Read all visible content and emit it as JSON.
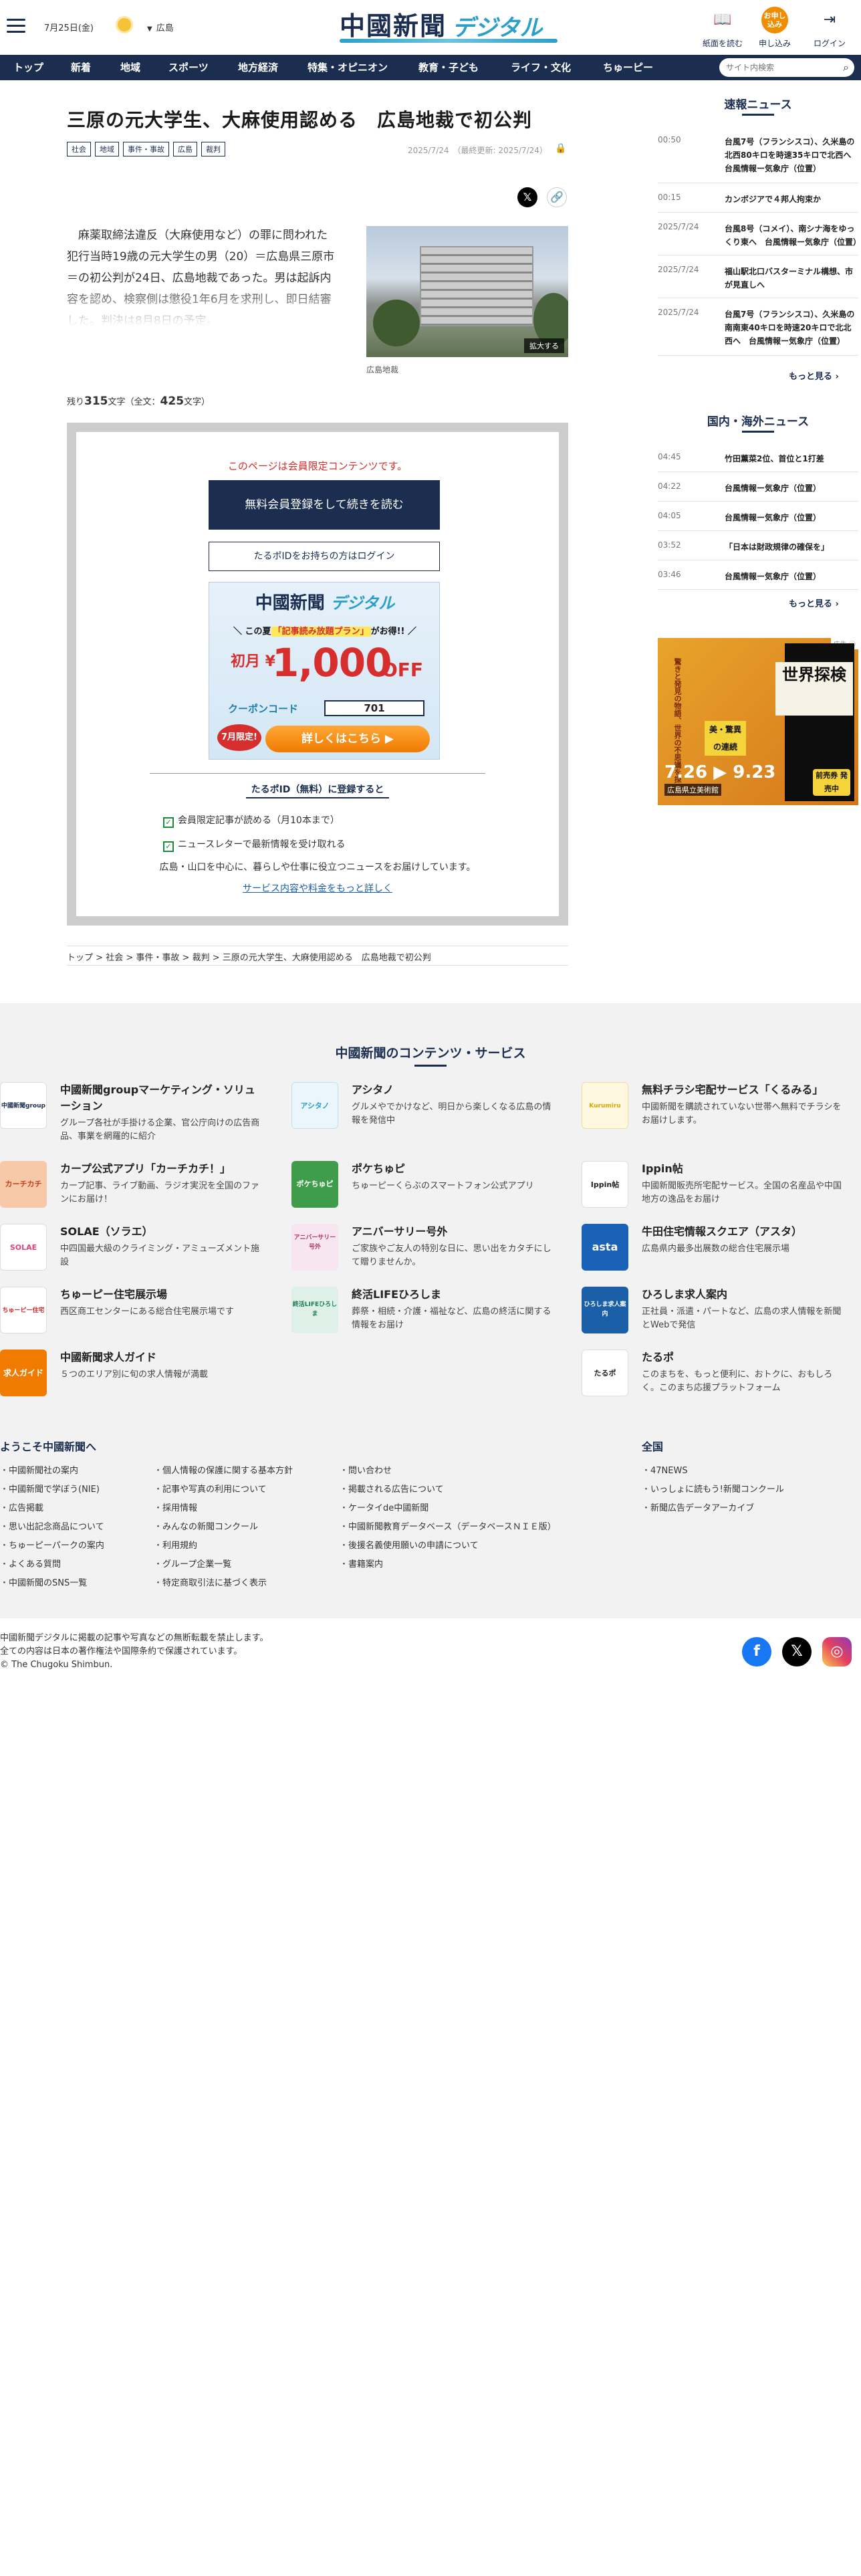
{
  "header": {
    "date": "7月25日(金)",
    "region": "広島",
    "logo_main": "中國新聞",
    "logo_sub": "デジタル",
    "btn_paper": "紙面を読む",
    "btn_apply_icon": "お申し込み",
    "btn_apply": "申し込み",
    "btn_login": "ログイン"
  },
  "nav": {
    "items": [
      "トップ",
      "新着",
      "地域",
      "スポーツ",
      "地方経済",
      "特集・オピニオン",
      "教育・子ども",
      "ライフ・文化",
      "ちゅーピー"
    ],
    "search_placeholder": "サイト内検索"
  },
  "article": {
    "title": "三原の元大学生、大麻使用認める　広島地裁で初公判",
    "tags": [
      "社会",
      "地域",
      "事件・事故",
      "広島",
      "裁判"
    ],
    "date": "2025/7/24",
    "updated": "（最終更新: 2025/7/24）",
    "lead": "麻薬取締法違反（大麻使用など）の罪に問われた犯行当時19歳の元大学生の男（20）＝広島県三原市＝の初公判が24日、広島地裁であった。男は起訴内容を認め、検察側は懲役1年6月を求刑し、即日結審した。判決は8月8日の予定。",
    "photo_expand": "拡大する",
    "photo_caption": "広島地裁",
    "remain_pre": "残り",
    "remain_num": "315",
    "remain_mid": "文字（全文：",
    "total_num": "425",
    "remain_post": "文字）"
  },
  "paywall": {
    "notice": "このページは会員限定コンテンツです。",
    "register": "無料会員登録をして続きを読む",
    "login": "たるポIDをお持ちの方はログイン",
    "banner_logo_main": "中國新聞",
    "banner_logo_sub": "デジタル",
    "banner_promo_pre": "＼ この夏",
    "banner_promo_em": "「記事読み放題プラン」",
    "banner_promo_post": "がお得!! ／",
    "banner_price_pre": "初月 ¥",
    "banner_price": "1,000",
    "banner_off": "OFF",
    "banner_coupon_label": "クーポンコード",
    "banner_coupon_code": "701",
    "banner_limit": "7月限定!",
    "banner_cta": "詳しくはこちら ▶",
    "benefit_heading": "たるポID（無料）に登録すると",
    "benefits": [
      "会員限定記事が読める（月10本まで）",
      "ニュースレターで最新情報を受け取れる"
    ],
    "desc": "広島・山口を中心に、暮らしや仕事に役立つニュースをお届けしています。",
    "more": "サービス内容や料金をもっと詳しく"
  },
  "breadcrumb": [
    "トップ",
    "社会",
    "事件・事故",
    "裁判",
    "三原の元大学生、大麻使用認める　広島地裁で初公判"
  ],
  "sidebar": {
    "breaking_title": "速報ニュース",
    "breaking": [
      {
        "time": "00:50",
        "headline": "台風7号（フランシスコ）、久米島の北西80キロを時速35キロで北西へ　台風情報ー気象庁（位置）"
      },
      {
        "time": "00:15",
        "headline": "カンボジアで４邦人拘束か"
      },
      {
        "time": "2025/7/24",
        "headline": "台風8号（コメイ）、南シナ海をゆっくり東へ　台風情報ー気象庁（位置）"
      },
      {
        "time": "2025/7/24",
        "headline": "福山駅北口バスターミナル構想、市が見直しへ"
      },
      {
        "time": "2025/7/24",
        "headline": "台風7号（フランシスコ）、久米島の南南東40キロを時速20キロで北北西へ　台風情報ー気象庁（位置）"
      }
    ],
    "more": "もっと見る ›",
    "world_title": "国内・海外ニュース",
    "world": [
      {
        "time": "04:45",
        "headline": "竹田薫菜2位、首位と1打差"
      },
      {
        "time": "04:22",
        "headline": "台風情報ー気象庁（位置）"
      },
      {
        "time": "04:05",
        "headline": "台風情報ー気象庁（位置）"
      },
      {
        "time": "03:52",
        "headline": "「日本は財政規律の確保を」"
      },
      {
        "time": "03:46",
        "headline": "台風情報ー気象庁（位置）"
      }
    ],
    "ad_badge": "広告 ⓘ",
    "ad_title": "世界探検",
    "ad_sub": "驚きと発見の物語、世界の不思議を探る",
    "ad_tag": "美・驚異 の連続",
    "ad_date": "7.26 ▶ 9.23",
    "ad_place": "広島県立美術館",
    "ad_free": "前売券 発売中"
  },
  "services": {
    "heading": "中國新聞のコンテンツ・サービス",
    "items": [
      {
        "name": "中國新聞groupマーケティング・ソリューション",
        "desc": "グループ各社が手掛ける企業、官公庁向けの広告商品、事業を網羅的に紹介",
        "icon_label": "中國新聞group"
      },
      {
        "name": "アシタノ",
        "desc": "グルメやでかけなど、明日から楽しくなる広島の情報を発信中",
        "icon_label": "アシタノ"
      },
      {
        "name": "無料チラシ宅配サービス「くるみる」",
        "desc": "中國新聞を購読されていない世帯へ無料でチラシをお届けします。",
        "icon_label": "Kurumiru"
      },
      {
        "name": "カープ公式アプリ「カーチカチ！」",
        "desc": "カープ記事、ライブ動画、ラジオ実況を全国のファンにお届け！",
        "icon_label": "カーチカチ"
      },
      {
        "name": "ポケちゅピ",
        "desc": "ちゅーピーくらぶのスマートフォン公式アプリ",
        "icon_label": "ポケちゅピ"
      },
      {
        "name": "Ippin帖",
        "desc": "中國新聞販売所宅配サービス。全国の名産品や中国地方の逸品をお届け",
        "icon_label": "Ippin帖"
      },
      {
        "name": "SOLAE（ソラエ）",
        "desc": "中四国最大級のクライミング・アミューズメント施設",
        "icon_label": "SOLAE"
      },
      {
        "name": "アニバーサリー号外",
        "desc": "ご家族やご友人の特別な日に、思い出をカタチにして贈りませんか。",
        "icon_label": "アニバーサリー号外"
      },
      {
        "name": "牛田住宅情報スクエア（アスタ）",
        "desc": "広島県内最多出展数の総合住宅展示場",
        "icon_label": "asta"
      },
      {
        "name": "ちゅーピー住宅展示場",
        "desc": "西区商工センターにある総合住宅展示場です",
        "icon_label": "ちゅーピー住宅"
      },
      {
        "name": "終活LIFEひろしま",
        "desc": "葬祭・相続・介護・福祉など、広島の終活に関する情報をお届け",
        "icon_label": "終活LIFEひろしま"
      },
      {
        "name": "ひろしま求人案内",
        "desc": "正社員・派遣・パートなど、広島の求人情報を新聞とWebで発信",
        "icon_label": "ひろしま求人案内"
      },
      {
        "name": "中國新聞求人ガイド",
        "desc": "５つのエリア別に旬の求人情報が満載",
        "icon_label": "求人ガイド"
      },
      {
        "name": "たるポ",
        "desc": "このまちを、もっと便利に、おトクに、おもしろく。このまち応援プラットフォーム",
        "icon_label": "たるポ"
      }
    ]
  },
  "footer": {
    "welcome": "ようこそ中國新聞へ",
    "zenkoku": "全国",
    "col1": [
      "中國新聞社の案内",
      "中國新聞で学ぼう(NIE)",
      "広告掲載",
      "思い出記念商品について",
      "ちゅーピーパークの案内",
      "よくある質問",
      "中國新聞のSNS一覧"
    ],
    "col2": [
      "個人情報の保護に関する基本方針",
      "記事や写真の利用について",
      "採用情報",
      "みんなの新聞コンクール",
      "利用規約",
      "グループ企業一覧",
      "特定商取引法に基づく表示"
    ],
    "col3": [
      "問い合わせ",
      "掲載される広告について",
      "ケータイde中國新聞",
      "中國新聞教育データベース（データベースＮＩＥ版）",
      "後援名義使用願いの申請について",
      "書籍案内"
    ],
    "col4": [
      "47NEWS",
      "いっしょに読もう!新聞コンクール",
      "新聞広告データアーカイブ"
    ],
    "copyright1": "中國新聞デジタルに掲載の記事や写真などの無断転載を禁止します。",
    "copyright2": "全ての内容は日本の著作権法や国際条約で保護されています。",
    "copyright3": "© The Chugoku Shimbun."
  },
  "colors": {
    "navy": "#1b2e50",
    "accent_blue": "#2b9fc7",
    "orange": "#f08c00",
    "red": "#d62d2d"
  }
}
